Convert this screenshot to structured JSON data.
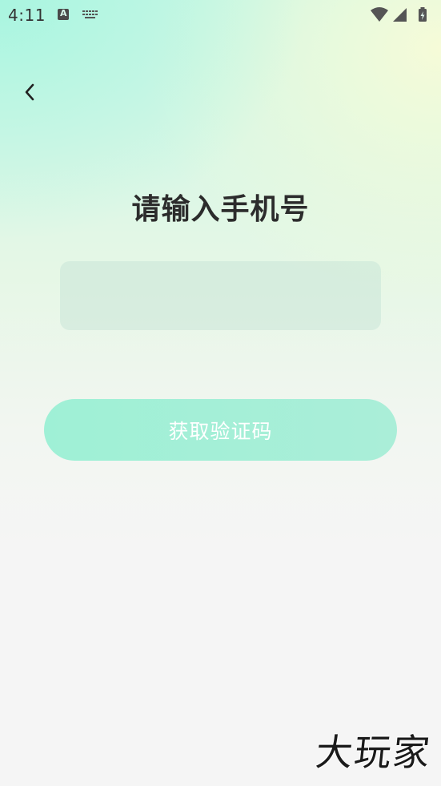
{
  "status_bar": {
    "time": "4:11",
    "icons": [
      "a-notification-icon",
      "keyboard-icon",
      "wifi-icon",
      "signal-icon",
      "battery-icon"
    ]
  },
  "nav": {
    "back_icon": "chevron-left-icon"
  },
  "main": {
    "title": "请输入手机号",
    "phone_input": {
      "value": "",
      "placeholder": ""
    },
    "get_code_label": "获取验证码"
  },
  "watermark": {
    "text": "大玩家"
  },
  "colors": {
    "button_gradient_start": "#9ff0d6",
    "button_gradient_end": "#aaeed8",
    "title": "#2c2c2c",
    "background_top_left": "#a9f5e0",
    "background_top_right": "#f6fbd8",
    "background_bottom": "#f5f5f5"
  }
}
